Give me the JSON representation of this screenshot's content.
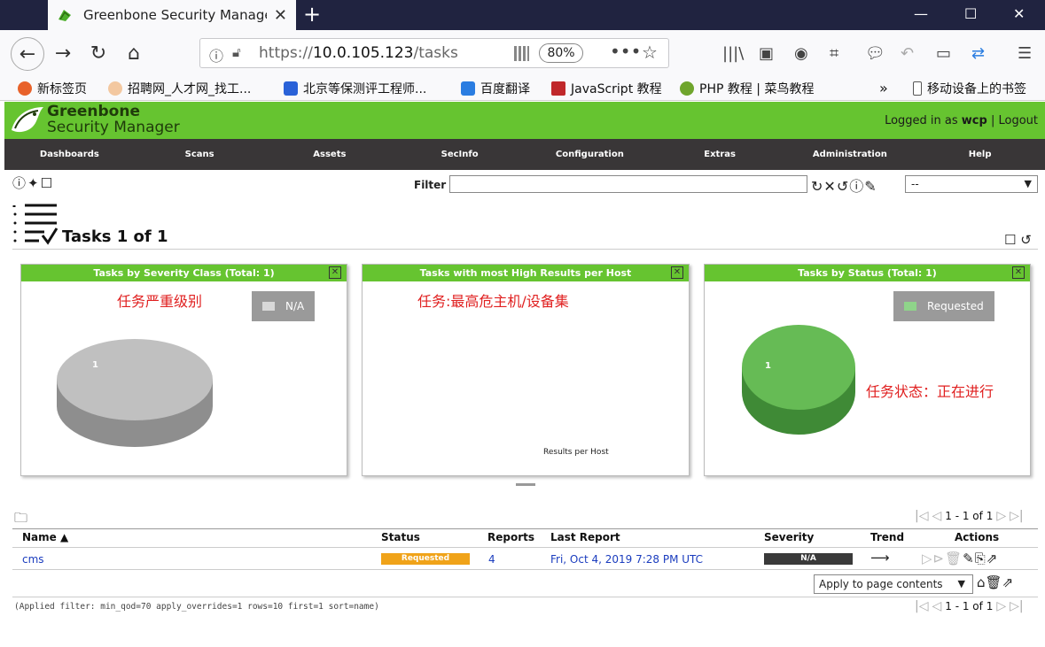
{
  "browser": {
    "tab_title": "Greenbone Security Manage",
    "url_prefix": "https://",
    "url_host": "10.0.105.123",
    "url_path": "/tasks",
    "zoom": "80%",
    "bookmarks": [
      "新标签页",
      "招聘网_人才网_找工...",
      "北京等保测评工程师...",
      "百度翻译",
      "JavaScript 教程",
      "PHP 教程 | 菜鸟教程",
      "移动设备上的书签"
    ]
  },
  "app": {
    "logo_line1": "Greenbone",
    "logo_line2": "Security Manager",
    "login_prefix": "Logged in as",
    "user": "wcp",
    "separator": "|",
    "logout": "Logout"
  },
  "menu": [
    "Dashboards",
    "Scans",
    "Assets",
    "SecInfo",
    "Configuration",
    "Extras",
    "Administration",
    "Help"
  ],
  "filter": {
    "label": "Filter",
    "value": "",
    "select_value": "--"
  },
  "page_title": "Tasks 1 of 1",
  "panels": [
    {
      "title": "Tasks by Severity Class (Total: 1)",
      "annotation": "任务严重级别",
      "legend": "N/A",
      "slice_label": "1",
      "color": "#c0c0c0"
    },
    {
      "title": "Tasks with most High Results per Host",
      "annotation": "任务:最高危主机/设备集",
      "x_label": "Results per Host"
    },
    {
      "title": "Tasks by Status (Total: 1)",
      "annotation": "任务状态：正在进行",
      "legend": "Requested",
      "slice_label": "1",
      "color": "#66bb55"
    }
  ],
  "table": {
    "pager": "1 - 1 of 1",
    "columns": [
      "Name ▲",
      "Status",
      "Reports",
      "Last Report",
      "Severity",
      "Trend",
      "Actions"
    ],
    "rows": [
      {
        "name": "cms",
        "status": "Requested",
        "reports": "4",
        "last_report": "Fri, Oct 4, 2019 7:28 PM UTC",
        "severity": "N/A",
        "trend": "⟶"
      }
    ],
    "bulk_select": "Apply to page contents",
    "applied_filter": "(Applied filter: min_qod=70 apply_overrides=1 rows=10 first=1 sort=name)"
  },
  "colors": {
    "brand_green": "#66c430",
    "menu_bg": "#393637",
    "status_requested": "#f0a319"
  }
}
